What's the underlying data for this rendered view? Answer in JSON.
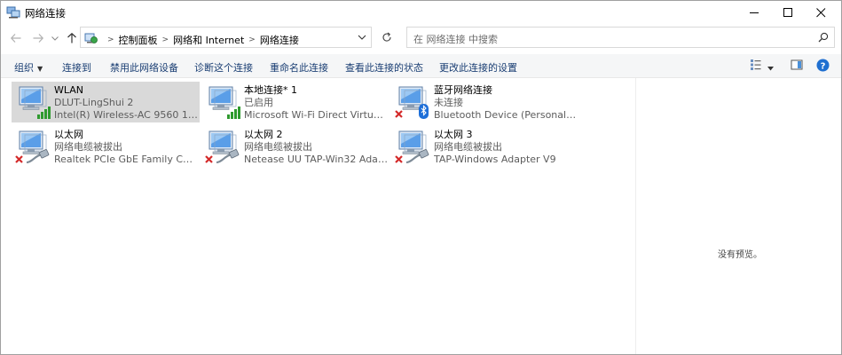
{
  "window": {
    "title": "网络连接",
    "minimize_glyph": "—",
    "maximize_glyph": "☐",
    "close_glyph": "✕"
  },
  "nav": {
    "back_icon": "arrow-left-icon",
    "forward_icon": "arrow-right-icon",
    "recent_icon": "chevron-down-icon",
    "up_icon": "arrow-up-icon",
    "breadcrumbs": [
      "控制面板",
      "网络和 Internet",
      "网络连接"
    ],
    "search_placeholder": "在 网络连接 中搜索"
  },
  "commands": {
    "organize": "组织",
    "connect": "连接到",
    "disable": "禁用此网络设备",
    "diagnose": "诊断这个连接",
    "rename": "重命名此连接",
    "view_status": "查看此连接的状态",
    "change_settings": "更改此连接的设置"
  },
  "connections": [
    {
      "name": "WLAN",
      "status": "DLUT-LingShui 2",
      "device": "Intel(R) Wireless-AC 9560 160...",
      "badge": "signal",
      "selected": true
    },
    {
      "name": "本地连接* 1",
      "status": "已启用",
      "device": "Microsoft Wi-Fi Direct Virtual ...",
      "badge": "signal",
      "selected": false
    },
    {
      "name": "蓝牙网络连接",
      "status": "未连接",
      "device": "Bluetooth Device (Personal Ar...",
      "badge": "bluetooth",
      "selected": false
    },
    {
      "name": "以太网",
      "status": "网络电缆被拔出",
      "device": "Realtek PCIe GbE Family Contr...",
      "badge": "cable",
      "selected": false
    },
    {
      "name": "以太网 2",
      "status": "网络电缆被拔出",
      "device": "Netease UU TAP-Win32 Adapt...",
      "badge": "cable",
      "selected": false
    },
    {
      "name": "以太网 3",
      "status": "网络电缆被拔出",
      "device": "TAP-Windows Adapter V9",
      "badge": "cable",
      "selected": false
    }
  ],
  "preview": {
    "text": "没有预览。"
  },
  "colors": {
    "selection": "#d9d9d9",
    "command_text": "#1a3e73",
    "signal_green": "#2e9a2e",
    "error_red": "#d42a2a",
    "bluetooth_blue": "#1e6fd9"
  }
}
